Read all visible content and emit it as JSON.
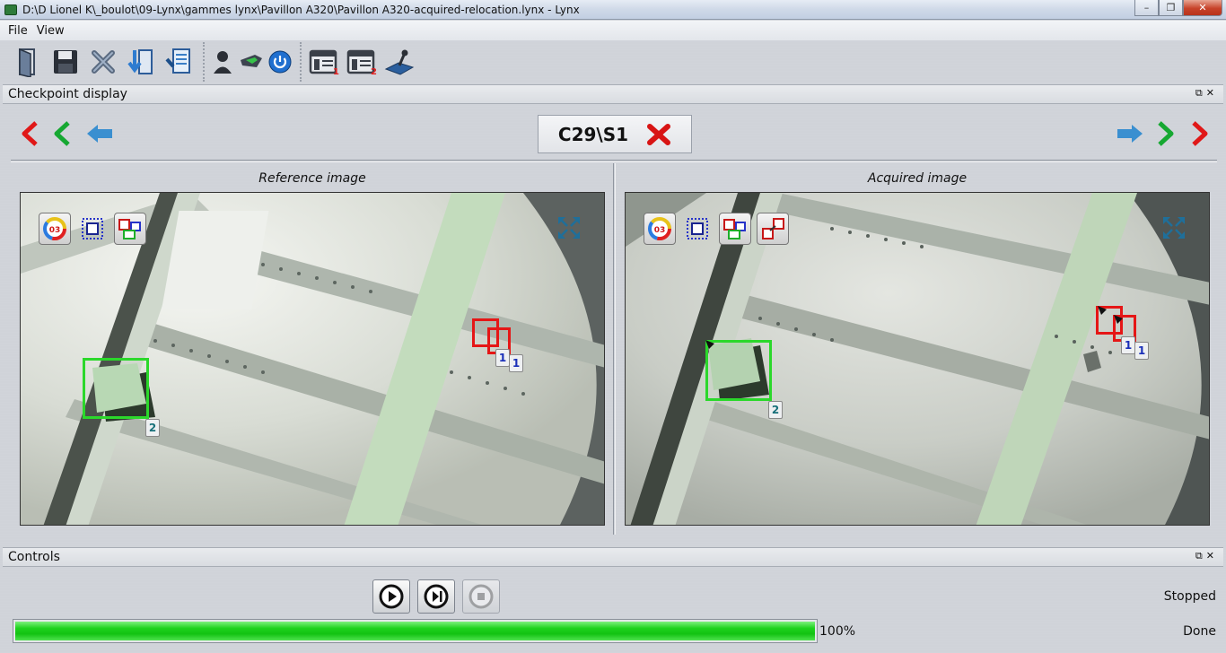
{
  "window": {
    "title": "D:\\D Lionel K\\_boulot\\09-Lynx\\gammes lynx\\Pavillon A320\\Pavillon A320-acquired-relocation.lynx - Lynx",
    "minimize": "–",
    "maximize": "❐",
    "close": "✕"
  },
  "menu": {
    "file": "File",
    "view": "View"
  },
  "toolbar": {
    "icons": [
      "open-icon",
      "save-icon",
      "close-file-icon",
      "import-icon",
      "export-icon",
      "user-icon",
      "hand-key-icon",
      "power-icon",
      "layout-1-icon",
      "layout-2-icon",
      "joystick-icon"
    ],
    "layout1_num": "1",
    "layout2_num": "2"
  },
  "checkpoint_panel": {
    "title": "Checkpoint display",
    "float": "⧉",
    "close": "✕",
    "checkpoint": "C29\\S1",
    "reference_caption": "Reference image",
    "acquired_caption": "Acquired image",
    "overlay_counter": "03",
    "reference_zones": [
      {
        "label": "1",
        "color": "red"
      },
      {
        "label": "1",
        "color": "red"
      },
      {
        "label": "2",
        "color": "green"
      }
    ],
    "acquired_zones": [
      {
        "label": "1",
        "color": "red"
      },
      {
        "label": "1",
        "color": "red"
      },
      {
        "label": "2",
        "color": "green"
      }
    ]
  },
  "controls_panel": {
    "title": "Controls",
    "float": "⧉",
    "close": "✕",
    "state": "Stopped",
    "progress_value": 100,
    "progress_text": "100%",
    "result": "Done"
  },
  "colors": {
    "accent_red": "#e51616",
    "accent_green": "#2bd82b",
    "progress_green": "#12c212",
    "arrow_blue": "#3a8fd0"
  }
}
